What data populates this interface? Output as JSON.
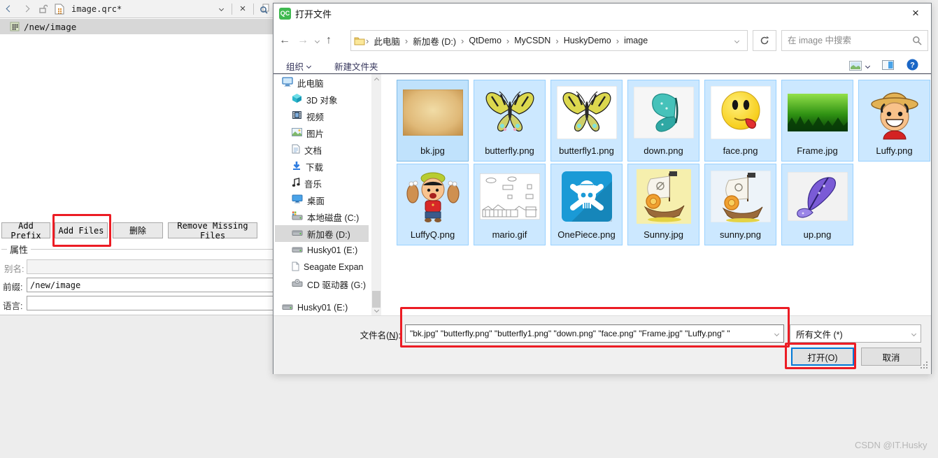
{
  "qt": {
    "tab_title": "image.qrc*",
    "tree_item": "/new/image",
    "buttons": [
      "Add Prefix",
      "Add Files",
      "删除",
      "Remove Missing Files"
    ],
    "props": {
      "group": "属性",
      "alias": "别名:",
      "prefix": "前缀:",
      "prefix_value": "/new/image",
      "language": "语言:"
    }
  },
  "dialog": {
    "logo": "QC",
    "title": "打开文件",
    "breadcrumb": [
      "此电脑",
      "新加卷 (D:)",
      "QtDemo",
      "MyCSDN",
      "HuskyDemo",
      "image"
    ],
    "search_placeholder": "在 image 中搜索",
    "organize": "组织",
    "new_folder": "新建文件夹",
    "sidebar": [
      {
        "label": "此电脑",
        "icon": "computer",
        "level": 0,
        "selected": false
      },
      {
        "label": "3D 对象",
        "icon": "cube",
        "level": 1,
        "selected": false
      },
      {
        "label": "视频",
        "icon": "video",
        "level": 1,
        "selected": false
      },
      {
        "label": "图片",
        "icon": "picture",
        "level": 1,
        "selected": false
      },
      {
        "label": "文档",
        "icon": "doc",
        "level": 1,
        "selected": false
      },
      {
        "label": "下载",
        "icon": "download",
        "level": 1,
        "selected": false
      },
      {
        "label": "音乐",
        "icon": "music",
        "level": 1,
        "selected": false
      },
      {
        "label": "桌面",
        "icon": "desktop",
        "level": 1,
        "selected": false
      },
      {
        "label": "本地磁盘 (C:)",
        "icon": "drive-win",
        "level": 1,
        "selected": false
      },
      {
        "label": "新加卷 (D:)",
        "icon": "drive",
        "level": 1,
        "selected": true
      },
      {
        "label": "Husky01 (E:)",
        "icon": "drive",
        "level": 1,
        "selected": false
      },
      {
        "label": "Seagate Expan",
        "icon": "page",
        "level": 1,
        "selected": false
      },
      {
        "label": "CD 驱动器 (G:)",
        "icon": "cd",
        "level": 1,
        "selected": false
      },
      {
        "label": "Husky01 (E:)",
        "icon": "drive",
        "level": 0,
        "selected": false,
        "gap": true
      }
    ],
    "files": [
      {
        "name": "bk.jpg",
        "thumb": "parchment",
        "cursor": true
      },
      {
        "name": "butterfly.png",
        "thumb": "butterfly-yellow",
        "cursor": false
      },
      {
        "name": "butterfly1.png",
        "thumb": "butterfly-yellow-white",
        "cursor": false
      },
      {
        "name": "down.png",
        "thumb": "butterfly-teal",
        "cursor": false
      },
      {
        "name": "face.png",
        "thumb": "smiley",
        "cursor": false
      },
      {
        "name": "Frame.jpg",
        "thumb": "forest",
        "cursor": false
      },
      {
        "name": "Luffy.png",
        "thumb": "luffy",
        "cursor": false
      },
      {
        "name": "LuffyQ.png",
        "thumb": "luffy-chibi",
        "cursor": false
      },
      {
        "name": "mario.gif",
        "thumb": "mario-sketch",
        "cursor": false
      },
      {
        "name": "OnePiece.png",
        "thumb": "jolly-roger",
        "cursor": false
      },
      {
        "name": "Sunny.jpg",
        "thumb": "ship-yellow",
        "cursor": false
      },
      {
        "name": "sunny.png",
        "thumb": "ship-light",
        "cursor": false
      },
      {
        "name": "up.png",
        "thumb": "butterfly-purple",
        "cursor": false
      }
    ],
    "filename_label_pre": "文件名(",
    "filename_label_key": "N",
    "filename_label_post": "):",
    "filename_value": "\"bk.jpg\" \"butterfly.png\" \"butterfly1.png\" \"down.png\" \"face.png\" \"Frame.jpg\" \"Luffy.png\" \"",
    "filetype_value": "所有文件 (*)",
    "open_label": "打开(O)",
    "cancel_label": "取消"
  },
  "watermark": "CSDN @IT.Husky",
  "annotation_color": "#ec1c24"
}
